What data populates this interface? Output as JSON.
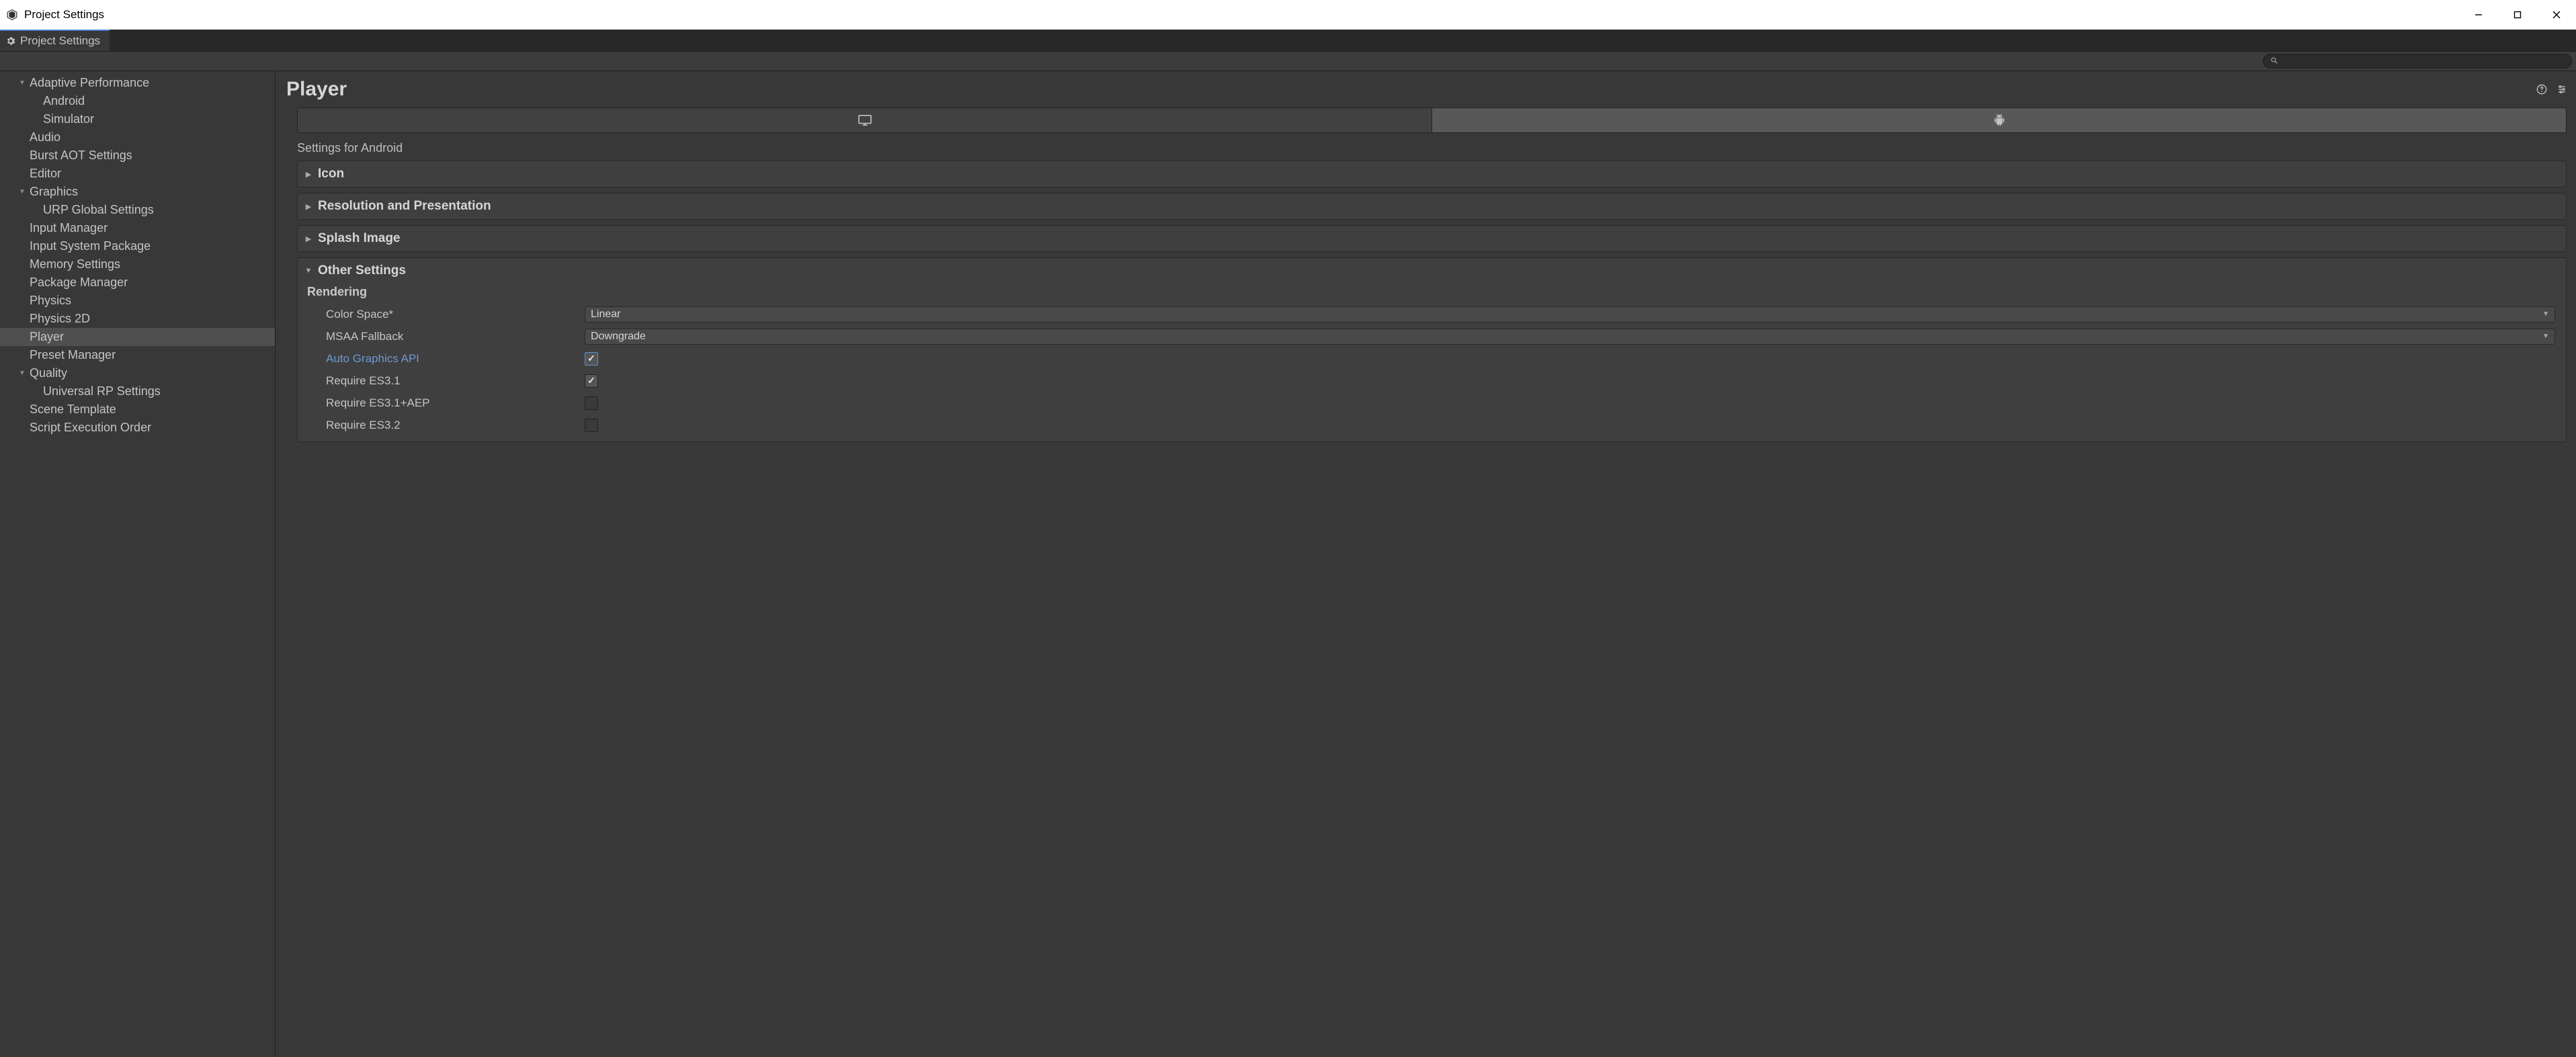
{
  "window": {
    "title": "Project Settings"
  },
  "tab": {
    "label": "Project Settings"
  },
  "search": {
    "value": ""
  },
  "sidebar": {
    "items": [
      {
        "label": "Adaptive Performance",
        "indent": 1,
        "expanded": true,
        "hasChildren": true,
        "selected": false
      },
      {
        "label": "Android",
        "indent": 2,
        "expanded": false,
        "hasChildren": false,
        "selected": false
      },
      {
        "label": "Simulator",
        "indent": 2,
        "expanded": false,
        "hasChildren": false,
        "selected": false
      },
      {
        "label": "Audio",
        "indent": 1,
        "expanded": false,
        "hasChildren": false,
        "selected": false
      },
      {
        "label": "Burst AOT Settings",
        "indent": 1,
        "expanded": false,
        "hasChildren": false,
        "selected": false
      },
      {
        "label": "Editor",
        "indent": 1,
        "expanded": false,
        "hasChildren": false,
        "selected": false
      },
      {
        "label": "Graphics",
        "indent": 1,
        "expanded": true,
        "hasChildren": true,
        "selected": false
      },
      {
        "label": "URP Global Settings",
        "indent": 2,
        "expanded": false,
        "hasChildren": false,
        "selected": false
      },
      {
        "label": "Input Manager",
        "indent": 1,
        "expanded": false,
        "hasChildren": false,
        "selected": false
      },
      {
        "label": "Input System Package",
        "indent": 1,
        "expanded": false,
        "hasChildren": false,
        "selected": false
      },
      {
        "label": "Memory Settings",
        "indent": 1,
        "expanded": false,
        "hasChildren": false,
        "selected": false
      },
      {
        "label": "Package Manager",
        "indent": 1,
        "expanded": false,
        "hasChildren": false,
        "selected": false
      },
      {
        "label": "Physics",
        "indent": 1,
        "expanded": false,
        "hasChildren": false,
        "selected": false
      },
      {
        "label": "Physics 2D",
        "indent": 1,
        "expanded": false,
        "hasChildren": false,
        "selected": false
      },
      {
        "label": "Player",
        "indent": 1,
        "expanded": false,
        "hasChildren": false,
        "selected": true
      },
      {
        "label": "Preset Manager",
        "indent": 1,
        "expanded": false,
        "hasChildren": false,
        "selected": false
      },
      {
        "label": "Quality",
        "indent": 1,
        "expanded": true,
        "hasChildren": true,
        "selected": false
      },
      {
        "label": "Universal RP Settings",
        "indent": 2,
        "expanded": false,
        "hasChildren": false,
        "selected": false
      },
      {
        "label": "Scene Template",
        "indent": 1,
        "expanded": false,
        "hasChildren": false,
        "selected": false
      },
      {
        "label": "Script Execution Order",
        "indent": 1,
        "expanded": false,
        "hasChildren": false,
        "selected": false
      }
    ]
  },
  "content": {
    "title": "Player",
    "platform_section_label": "Settings for Android",
    "foldouts": [
      {
        "title": "Icon",
        "expanded": false
      },
      {
        "title": "Resolution and Presentation",
        "expanded": false
      },
      {
        "title": "Splash Image",
        "expanded": false
      }
    ],
    "other_settings": {
      "title": "Other Settings",
      "subhead": "Rendering",
      "rows": [
        {
          "label": "Color Space*",
          "type": "dropdown",
          "value": "Linear",
          "highlight": false
        },
        {
          "label": "MSAA Fallback",
          "type": "dropdown",
          "value": "Downgrade",
          "highlight": false
        },
        {
          "label": "Auto Graphics API",
          "type": "checkbox",
          "checked": true,
          "highlight": true,
          "focused": true
        },
        {
          "label": "Require ES3.1",
          "type": "checkbox",
          "checked": true,
          "highlight": false
        },
        {
          "label": "Require ES3.1+AEP",
          "type": "checkbox",
          "checked": false,
          "highlight": false
        },
        {
          "label": "Require ES3.2",
          "type": "checkbox",
          "checked": false,
          "highlight": false
        }
      ]
    }
  }
}
